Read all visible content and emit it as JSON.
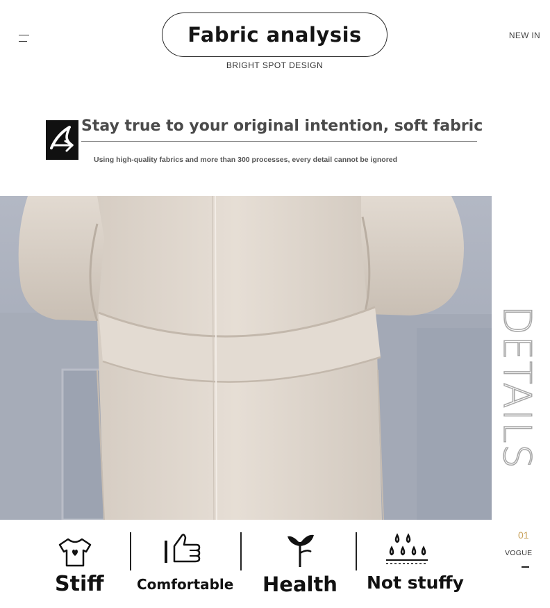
{
  "header": {
    "title": "Fabric analysis",
    "subtitle": "BRIGHT SPOT DESIGN",
    "new_in": "NEW IN"
  },
  "intro": {
    "headline": "Stay true to your original intention, soft fabric",
    "description": "Using high-quality fabrics and more than 300 processes, every detail cannot be ignored"
  },
  "side": {
    "details_word": "DETAILS",
    "page_number": "01",
    "vogue": "VOGUE"
  },
  "features": [
    {
      "label": "Stiff",
      "icon": "tshirt-icon"
    },
    {
      "label": "Comfortable",
      "icon": "thumbs-up-icon"
    },
    {
      "label": "Health",
      "icon": "sprout-icon"
    },
    {
      "label": "Not stuffy",
      "icon": "water-drops-icon"
    }
  ],
  "colors": {
    "accent_gold": "#c9a25b",
    "coat": "#ddd5cc",
    "background_wall": "#a3a9b6"
  }
}
